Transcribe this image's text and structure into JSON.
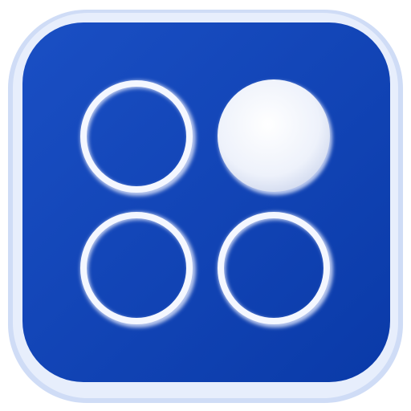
{
  "icon": {
    "name": "four-dots-grid-app-icon",
    "background_color": "#ffffff",
    "frame_color": "#e7eefc",
    "frame_edge_color": "#cfdcf6",
    "tile_color": "#0a3aa8",
    "tile_highlight_color": "#1a4fc4",
    "ring_color": "#f4f7ff",
    "ring_shadow_color": "#b9c8ee",
    "filled_dot_color": "#eef2fb",
    "filled_dot_shade_color": "#cfd8ee",
    "dots": [
      {
        "name": "top-left-ring-icon",
        "filled": false
      },
      {
        "name": "top-right-filled-dot-icon",
        "filled": true
      },
      {
        "name": "bottom-left-ring-icon",
        "filled": false
      },
      {
        "name": "bottom-right-ring-icon",
        "filled": false
      }
    ]
  }
}
